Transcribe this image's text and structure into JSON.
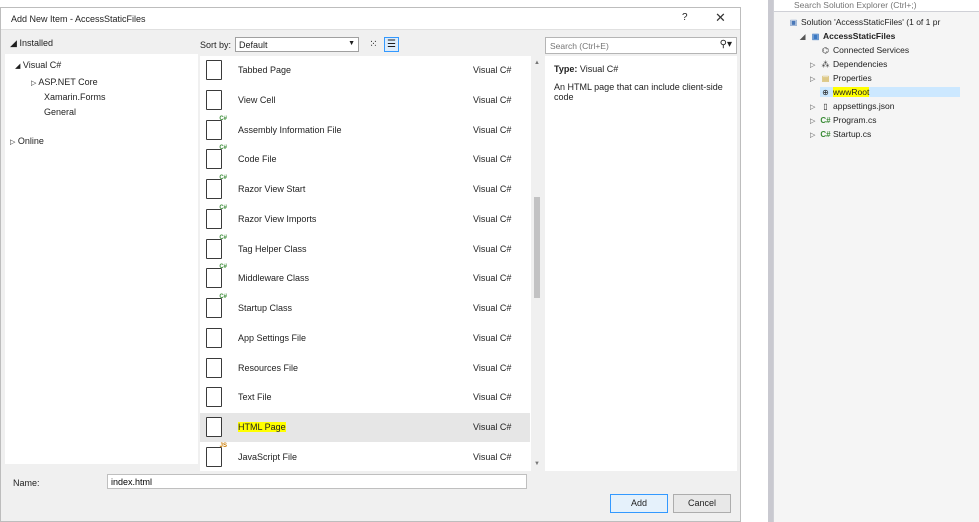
{
  "dialog": {
    "title": "Add New Item - AccessStaticFiles",
    "help": "?",
    "close": "✕",
    "installed_header": "Installed",
    "tree": [
      {
        "label": "Visual C#",
        "selected": true
      },
      {
        "label": "ASP.NET Core"
      },
      {
        "label": "Xamarin.Forms"
      },
      {
        "label": "General"
      }
    ],
    "online": "Online",
    "sort_label": "Sort by:",
    "sort_value": "Default",
    "search_placeholder": "Search (Ctrl+E)",
    "templates": [
      {
        "name": "Tabbed Page",
        "lang": "Visual C#",
        "icon": "html-page-icon"
      },
      {
        "name": "View Cell",
        "lang": "Visual C#",
        "icon": "view-cell-icon"
      },
      {
        "name": "Assembly Information File",
        "lang": "Visual C#",
        "icon": "assembly-info-icon"
      },
      {
        "name": "Code File",
        "lang": "Visual C#",
        "icon": "code-file-icon"
      },
      {
        "name": "Razor View Start",
        "lang": "Visual C#",
        "icon": "razor-file-icon"
      },
      {
        "name": "Razor View Imports",
        "lang": "Visual C#",
        "icon": "razor-file-icon"
      },
      {
        "name": "Tag Helper Class",
        "lang": "Visual C#",
        "icon": "class-file-icon"
      },
      {
        "name": "Middleware Class",
        "lang": "Visual C#",
        "icon": "class-file-icon"
      },
      {
        "name": "Startup Class",
        "lang": "Visual C#",
        "icon": "class-file-icon"
      },
      {
        "name": "App Settings File",
        "lang": "Visual C#",
        "icon": "settings-file-icon"
      },
      {
        "name": "Resources File",
        "lang": "Visual C#",
        "icon": "resources-file-icon"
      },
      {
        "name": "Text File",
        "lang": "Visual C#",
        "icon": "text-file-icon"
      },
      {
        "name": "HTML Page",
        "lang": "Visual C#",
        "icon": "html-page-icon",
        "selected": true
      },
      {
        "name": "JavaScript File",
        "lang": "Visual C#",
        "icon": "javascript-file-icon"
      }
    ],
    "info": {
      "type_label": "Type:",
      "type_value": "Visual C#",
      "description": "An HTML page that can include client-side code"
    },
    "name_label": "Name:",
    "name_value": "index.html",
    "add_label": "Add",
    "cancel_label": "Cancel"
  },
  "solution_explorer": {
    "search_placeholder": "Search Solution Explorer (Ctrl+;)",
    "items": [
      {
        "label": "Solution 'AccessStaticFiles' (1 of 1 pr",
        "icon": "solution-icon"
      },
      {
        "label": "AccessStaticFiles",
        "icon": "project-icon"
      },
      {
        "label": "Connected Services",
        "icon": "connected-services-icon"
      },
      {
        "label": "Dependencies",
        "icon": "dependencies-icon"
      },
      {
        "label": "Properties",
        "icon": "properties-icon"
      },
      {
        "label": "wwwRoot",
        "icon": "globe-icon",
        "selected": true
      },
      {
        "label": "appsettings.json",
        "icon": "json-file-icon"
      },
      {
        "label": "Program.cs",
        "icon": "csharp-file-icon"
      },
      {
        "label": "Startup.cs",
        "icon": "csharp-file-icon"
      }
    ]
  }
}
